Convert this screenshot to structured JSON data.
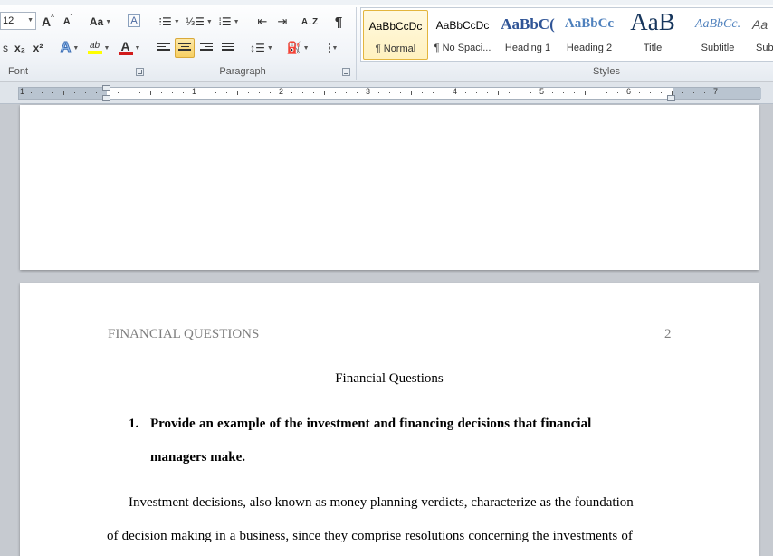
{
  "ribbon": {
    "font_group": {
      "label": "Font",
      "size_value": "12",
      "grow_label": "A",
      "shrink_label": "A",
      "change_case_label": "Aa",
      "clear_format_label": "A",
      "subscript_label": "x₂",
      "superscript_label": "x²",
      "text_effects_label": "A",
      "highlight_label": "ab",
      "font_color_label": "A",
      "highlight_color": "#ffff00",
      "font_color": "#d21c1c"
    },
    "paragraph_group": {
      "label": "Paragraph",
      "pilcrow": "¶",
      "sort_label": "A↓Z"
    },
    "styles_group": {
      "label": "Styles",
      "items": [
        {
          "sample": "AaBbCcDc",
          "name": "¶ Normal"
        },
        {
          "sample": "AaBbCcDc",
          "name": "¶ No Spaci..."
        },
        {
          "sample": "AaBbC(",
          "name": "Heading 1"
        },
        {
          "sample": "AaBbCc",
          "name": "Heading 2"
        },
        {
          "sample": "AaB",
          "name": "Title"
        },
        {
          "sample": "AaBbCc.",
          "name": "Subtitle"
        },
        {
          "sample": "Aa",
          "name": "Sub"
        }
      ]
    }
  },
  "ruler": {
    "numbers": [
      "1",
      "1",
      "2",
      "3",
      "4",
      "5",
      "6",
      "7"
    ]
  },
  "document": {
    "running_header": "FINANCIAL QUESTIONS",
    "page_number": "2",
    "title": "Financial Questions",
    "question_number": "1.",
    "question_line1": "Provide an example of the investment and financing decisions that financial",
    "question_line2": "managers make.",
    "body_line1": "Investment decisions, also known as money planning verdicts, characterize as the foundation",
    "body_line2": "of decision making in a business, since they comprise resolutions concerning the investments of"
  },
  "colors": {
    "accent_selected": "#f7cf62",
    "heading_blue": "#2f5496",
    "page_background": "#c6cad0"
  }
}
